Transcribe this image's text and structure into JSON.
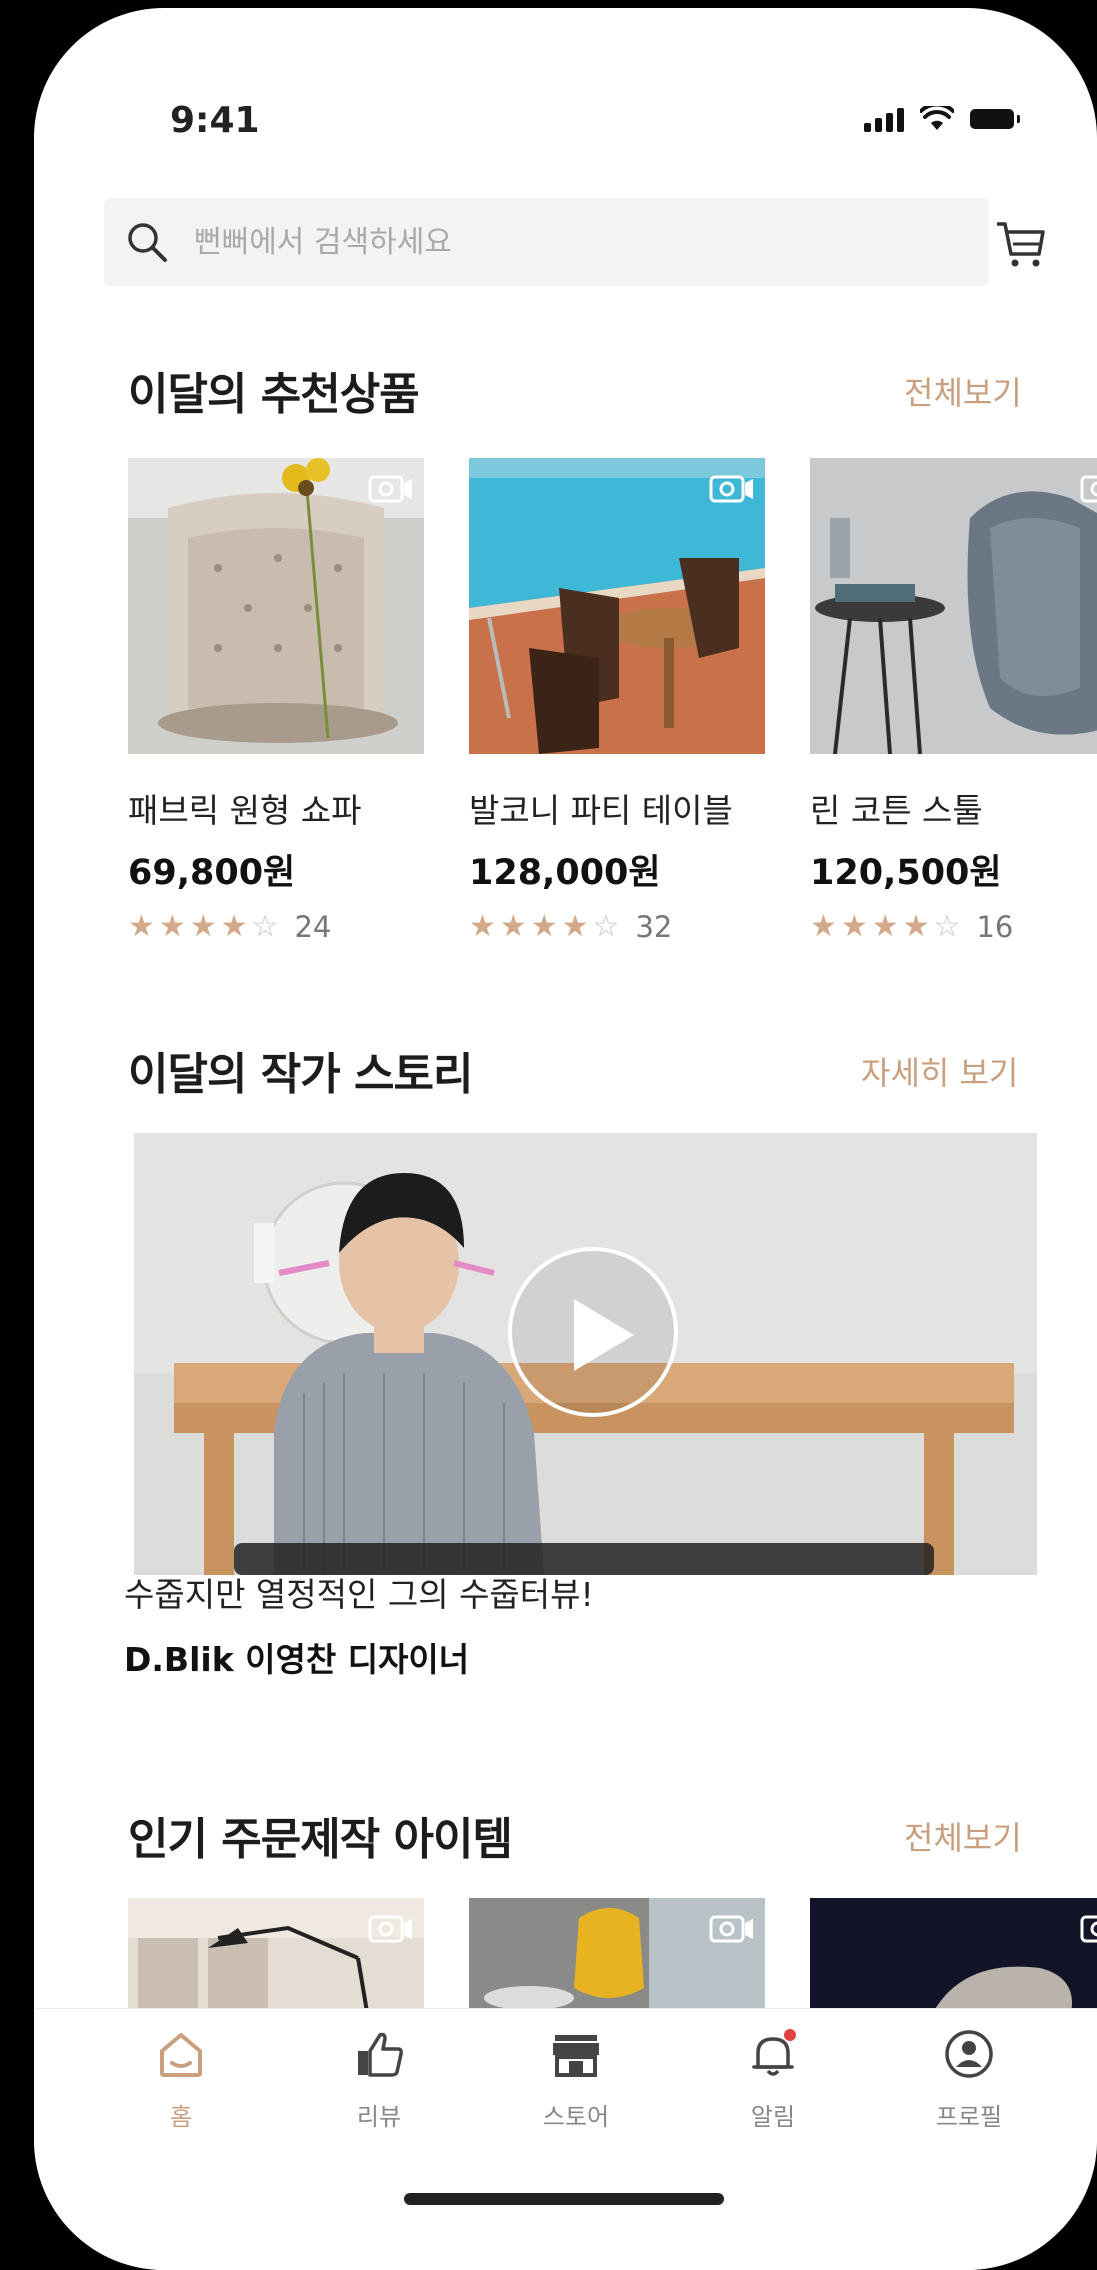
{
  "status": {
    "time": "9:41"
  },
  "search": {
    "placeholder": "뻔뻐에서 검색하세요"
  },
  "sections": {
    "recommended": {
      "title": "이달의 추천상품",
      "link": "전체보기"
    },
    "story": {
      "title": "이달의 작가 스토리",
      "link": "자세히 보기"
    },
    "popular": {
      "title": "인기 주문제작 아이템",
      "link": "전체보기"
    }
  },
  "products": [
    {
      "name": "패브릭 원형 쇼파",
      "price": "69,800원",
      "rating": 4,
      "reviews": "24"
    },
    {
      "name": "발코니 파티 테이블",
      "price": "128,000원",
      "rating": 4,
      "reviews": "32"
    },
    {
      "name": "린 코튼 스툴",
      "price": "120,500원",
      "rating": 4,
      "reviews": "16"
    }
  ],
  "story": {
    "caption_title": "수줍지만 열정적인 그의 수줍터뷰!",
    "caption_author": "D.Blik 이영찬 디자이너"
  },
  "tabs": [
    {
      "label": "홈",
      "icon": "home-icon",
      "active": true
    },
    {
      "label": "리뷰",
      "icon": "thumbs-up-icon",
      "active": false
    },
    {
      "label": "스토어",
      "icon": "store-icon",
      "active": false
    },
    {
      "label": "알림",
      "icon": "bell-icon",
      "active": false
    },
    {
      "label": "프로필",
      "icon": "profile-icon",
      "active": false
    }
  ],
  "colors": {
    "accent": "#c9a07f",
    "star": "#d2aa8b",
    "badge": "#e0443e"
  }
}
